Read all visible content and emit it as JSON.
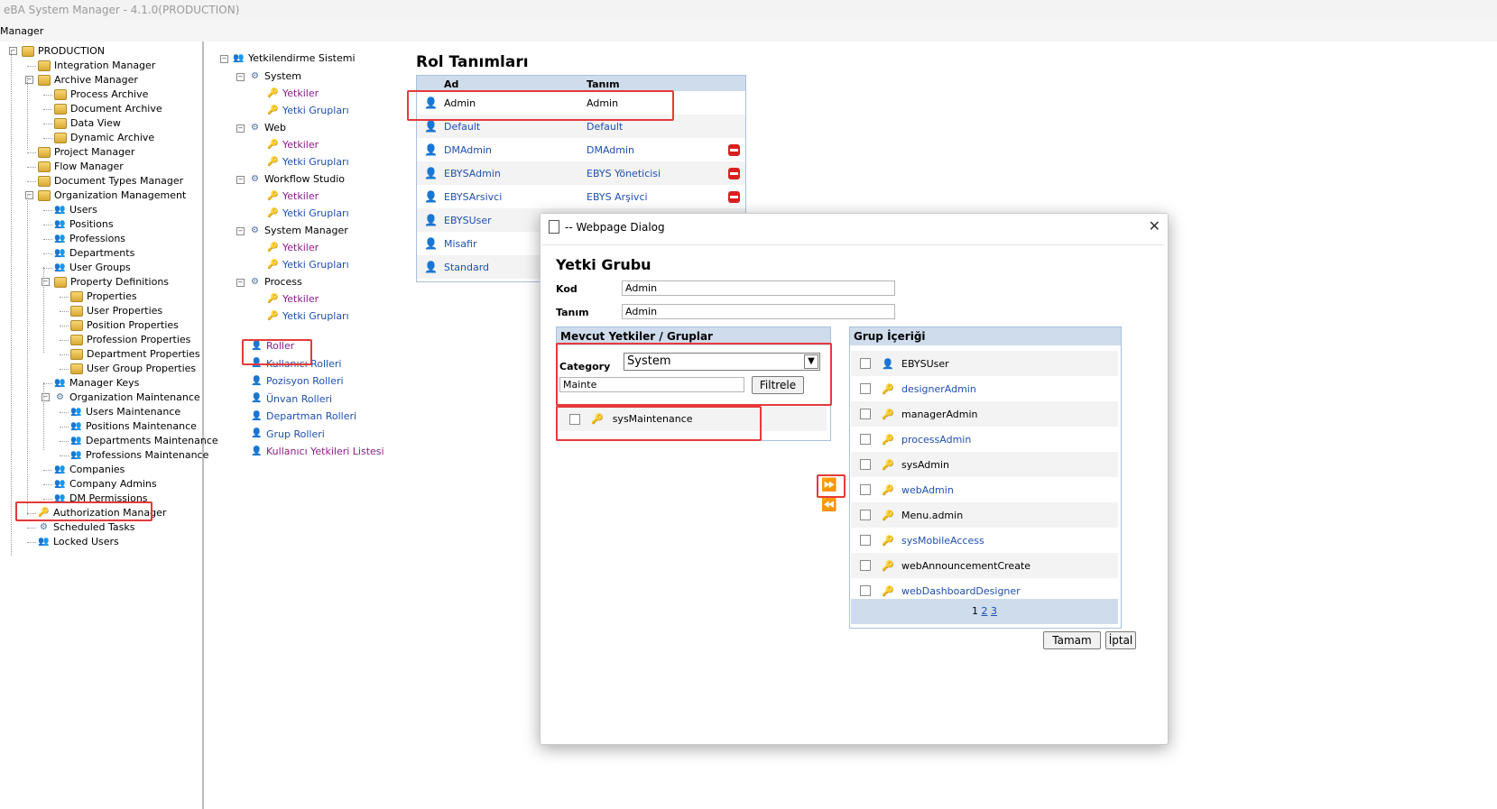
{
  "window": {
    "title": "eBA System Manager - 4.1.0(PRODUCTION)",
    "menu_label": "Manager"
  },
  "left_tree": {
    "items": [
      {
        "label": "PRODUCTION",
        "level": 0
      },
      {
        "label": "Integration Manager",
        "level": 1
      },
      {
        "label": "Archive Manager",
        "level": 1
      },
      {
        "label": "Process Archive",
        "level": 2
      },
      {
        "label": "Document Archive",
        "level": 2
      },
      {
        "label": "Data View",
        "level": 2
      },
      {
        "label": "Dynamic Archive",
        "level": 2
      },
      {
        "label": "Project Manager",
        "level": 1
      },
      {
        "label": "Flow Manager",
        "level": 1
      },
      {
        "label": "Document Types Manager",
        "level": 1
      },
      {
        "label": "Organization Management",
        "level": 1
      },
      {
        "label": "Users",
        "level": 2
      },
      {
        "label": "Positions",
        "level": 2
      },
      {
        "label": "Professions",
        "level": 2
      },
      {
        "label": "Departments",
        "level": 2
      },
      {
        "label": "User Groups",
        "level": 2
      },
      {
        "label": "Property Definitions",
        "level": 2
      },
      {
        "label": "Properties",
        "level": 3
      },
      {
        "label": "User Properties",
        "level": 3
      },
      {
        "label": "Position Properties",
        "level": 3
      },
      {
        "label": "Profession Properties",
        "level": 3
      },
      {
        "label": "Department Properties",
        "level": 3
      },
      {
        "label": "User Group Properties",
        "level": 3
      },
      {
        "label": "Manager Keys",
        "level": 2
      },
      {
        "label": "Organization Maintenance",
        "level": 2
      },
      {
        "label": "Users Maintenance",
        "level": 3
      },
      {
        "label": "Positions Maintenance",
        "level": 3
      },
      {
        "label": "Departments Maintenance",
        "level": 3
      },
      {
        "label": "Professions Maintenance",
        "level": 3
      },
      {
        "label": "Companies",
        "level": 2
      },
      {
        "label": "Company Admins",
        "level": 2
      },
      {
        "label": "DM Permissions",
        "level": 2
      },
      {
        "label": "Authorization Manager",
        "level": 1
      },
      {
        "label": "Scheduled Tasks",
        "level": 1
      },
      {
        "label": "Locked Users",
        "level": 1
      }
    ]
  },
  "mid_tree": {
    "root": "Yetkilendirme Sistemi",
    "groups": [
      {
        "label": "System",
        "children": [
          "Yetkiler",
          "Yetki Grupları"
        ]
      },
      {
        "label": "Web",
        "children": [
          "Yetkiler",
          "Yetki Grupları"
        ]
      },
      {
        "label": "Workflow Studio",
        "children": [
          "Yetkiler",
          "Yetki Grupları"
        ]
      },
      {
        "label": "System Manager",
        "children": [
          "Yetkiler",
          "Yetki Grupları"
        ]
      },
      {
        "label": "Process",
        "children": [
          "Yetkiler",
          "Yetki Grupları"
        ]
      }
    ],
    "links": [
      "Roller",
      "Kullanıcı Rolleri",
      "Pozisyon Rolleri",
      "Ünvan Rolleri",
      "Departman Rolleri",
      "Grup Rolleri",
      "Kullanıcı Yetkileri Listesi"
    ]
  },
  "roles": {
    "title": "Rol Tanımları",
    "col_ad": "Ad",
    "col_tanim": "Tanım",
    "rows": [
      {
        "ad": "Admin",
        "tanim": "Admin",
        "deletable": false
      },
      {
        "ad": "Default",
        "tanim": "Default",
        "deletable": false
      },
      {
        "ad": "DMAdmin",
        "tanim": "DMAdmin",
        "deletable": true
      },
      {
        "ad": "EBYSAdmin",
        "tanim": "EBYS Yöneticisi",
        "deletable": true
      },
      {
        "ad": "EBYSArsivci",
        "tanim": "EBYS Arşivci",
        "deletable": true
      },
      {
        "ad": "EBYSUser",
        "tanim": "",
        "deletable": false
      },
      {
        "ad": "Misafir",
        "tanim": "",
        "deletable": false
      },
      {
        "ad": "Standard",
        "tanim": "",
        "deletable": false
      }
    ]
  },
  "dialog": {
    "title": "-- Webpage Dialog",
    "heading": "Yetki Grubu",
    "kod_label": "Kod",
    "kod_value": "Admin",
    "tanim_label": "Tanım",
    "tanim_value": "Admin",
    "available": {
      "header": "Mevcut Yetkiler / Gruplar",
      "category_label": "Category",
      "category_value": "System",
      "filter_value": "Mainte",
      "filter_button": "Filtrele",
      "items": [
        "sysMaintenance"
      ]
    },
    "group_content": {
      "header": "Grup İçeriği",
      "items": [
        {
          "label": "EBYSUser",
          "icon": "role-icon",
          "link": false
        },
        {
          "label": "designerAdmin",
          "icon": "key-group-icon",
          "link": true
        },
        {
          "label": "managerAdmin",
          "icon": "key-group-icon",
          "link": false
        },
        {
          "label": "processAdmin",
          "icon": "key-group-icon",
          "link": true
        },
        {
          "label": "sysAdmin",
          "icon": "key-group-icon",
          "link": false
        },
        {
          "label": "webAdmin",
          "icon": "key-group-icon",
          "link": true
        },
        {
          "label": "Menu.admin",
          "icon": "key-icon",
          "link": false
        },
        {
          "label": "sysMobileAccess",
          "icon": "key-icon",
          "link": true
        },
        {
          "label": "webAnnouncementCreate",
          "icon": "key-icon",
          "link": false
        },
        {
          "label": "webDashboardDesigner",
          "icon": "key-icon",
          "link": true
        }
      ],
      "pager": {
        "p1": "1",
        "p2": "2",
        "p3": "3"
      }
    },
    "ok_button": "Tamam",
    "cancel_button": "İptal",
    "add_symbol": "⏩",
    "remove_symbol": "⏪"
  }
}
